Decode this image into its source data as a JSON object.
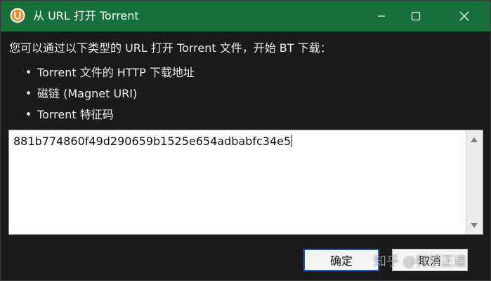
{
  "window": {
    "title": "从 URL 打开 Torrent",
    "app_icon": "utorrent-logo-icon",
    "controls": {
      "minimize_icon": "minimize-icon",
      "maximize_icon": "maximize-icon",
      "close_icon": "close-icon"
    }
  },
  "main": {
    "description": "您可以通过以下类型的 URL 打开 Torrent 文件，开始 BT 下载：",
    "options": [
      "Torrent 文件的 HTTP 下载地址",
      "磁链 (Magnet URI)",
      "Torrent 特征码"
    ],
    "url_input": {
      "value": "881b774860f49d290659b1525e654adbabfc34e5"
    }
  },
  "footer": {
    "ok_label": "确定",
    "cancel_label": "取消"
  },
  "watermark": "知乎 @科学正道",
  "colors": {
    "titlebar": "#176f3a",
    "background": "#1b1b1b",
    "focus_border": "#1d5fb8"
  }
}
